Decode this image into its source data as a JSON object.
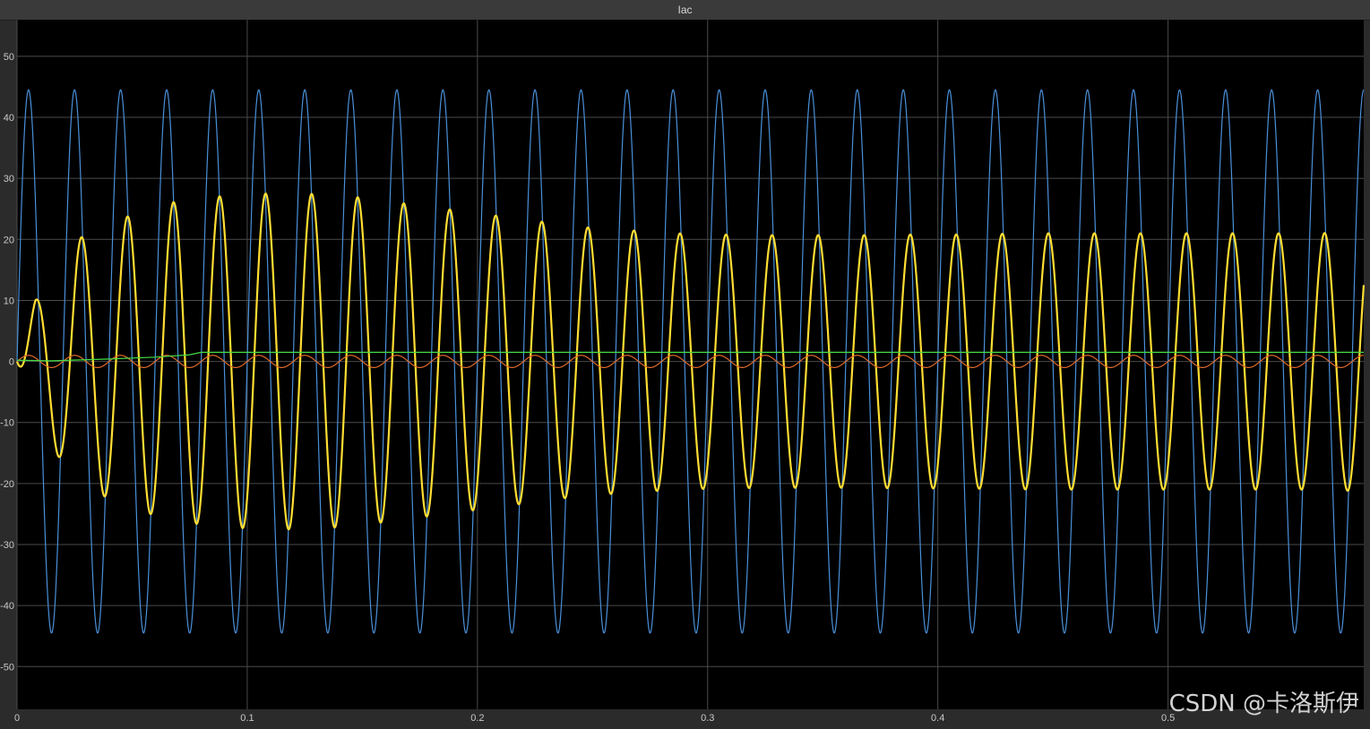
{
  "window": {
    "title": "Iac"
  },
  "watermark": "CSDN @卡洛斯伊",
  "colors": {
    "background": "#000000",
    "axes_frame": "#2b2b2b",
    "grid": "#4a4a4a",
    "tick_text": "#c8c8c8",
    "blue": "#4a90d9",
    "yellow": "#ffdd33",
    "orange": "#e06a2a",
    "green": "#44dd44"
  },
  "chart_data": {
    "type": "line",
    "title": "Iac",
    "xlabel": "",
    "ylabel": "",
    "xlim": [
      0,
      0.585
    ],
    "ylim": [
      -57,
      56
    ],
    "x_ticks": [
      0,
      0.1,
      0.2,
      0.3,
      0.4,
      0.5
    ],
    "x_tick_labels": [
      "0",
      "0.1",
      "0.2",
      "0.3",
      "0.4",
      "0.5"
    ],
    "y_ticks": [
      50,
      40,
      30,
      20,
      10,
      0,
      -10,
      -20,
      -30,
      -40,
      -50
    ],
    "y_tick_labels": [
      "50",
      "40",
      "30",
      "20",
      "10",
      "0",
      "-10",
      "-20",
      "-30",
      "-40",
      "-50"
    ],
    "grid": true,
    "legend": "none",
    "series": [
      {
        "color": "#4a90d9",
        "kind": "sine",
        "frequency_hz": 50,
        "amplitude": 44.5,
        "offset": 0
      },
      {
        "color": "#ffdd33",
        "kind": "sine_envelope",
        "frequency_hz": 50,
        "envelope_times": [
          0.008,
          0.026,
          0.046,
          0.066,
          0.086,
          0.106,
          0.126,
          0.146,
          0.166,
          0.186,
          0.206,
          0.226,
          0.246,
          0.266,
          0.286,
          0.306,
          0.326,
          0.346,
          0.366,
          0.386,
          0.406,
          0.426,
          0.446,
          0.466,
          0.486,
          0.506,
          0.526,
          0.546,
          0.566,
          0.586
        ],
        "envelope_amplitudes": [
          10,
          20,
          23.5,
          26,
          27,
          27.5,
          27.5,
          27,
          26,
          25,
          24,
          23,
          22,
          21.5,
          21,
          20.8,
          20.7,
          20.7,
          20.7,
          20.8,
          20.8,
          20.9,
          21,
          21,
          21,
          21,
          21,
          21,
          21,
          21.3
        ]
      },
      {
        "color": "#e06a2a",
        "kind": "sine",
        "frequency_hz": 50,
        "amplitude": 1,
        "offset": 0
      },
      {
        "color": "#44dd44",
        "kind": "step_response",
        "x": [
          0,
          0.015,
          0.04,
          0.06,
          0.075,
          0.08,
          0.585
        ],
        "y": [
          0.2,
          0.1,
          0.4,
          0.7,
          1.1,
          1.5,
          1.5
        ]
      }
    ]
  }
}
